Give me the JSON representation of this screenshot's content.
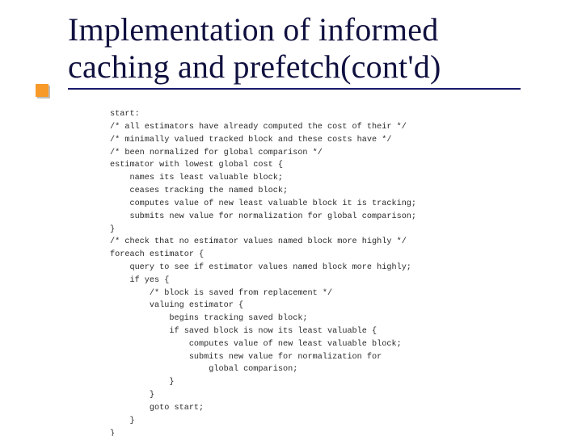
{
  "title_line1": "Implementation of informed",
  "title_line2": "caching and prefetch(cont'd)",
  "code": "start:\n/* all estimators have already computed the cost of their */\n/* minimally valued tracked block and these costs have */\n/* been normalized for global comparison */\nestimator with lowest global cost {\n    names its least valuable block;\n    ceases tracking the named block;\n    computes value of new least valuable block it is tracking;\n    submits new value for normalization for global comparison;\n}\n/* check that no estimator values named block more highly */\nforeach estimator {\n    query to see if estimator values named block more highly;\n    if yes {\n        /* block is saved from replacement */\n        valuing estimator {\n            begins tracking saved block;\n            if saved block is now its least valuable {\n                computes value of new least valuable block;\n                submits new value for normalization for\n                    global comparison;\n            }\n        }\n        goto start;\n    }\n}"
}
